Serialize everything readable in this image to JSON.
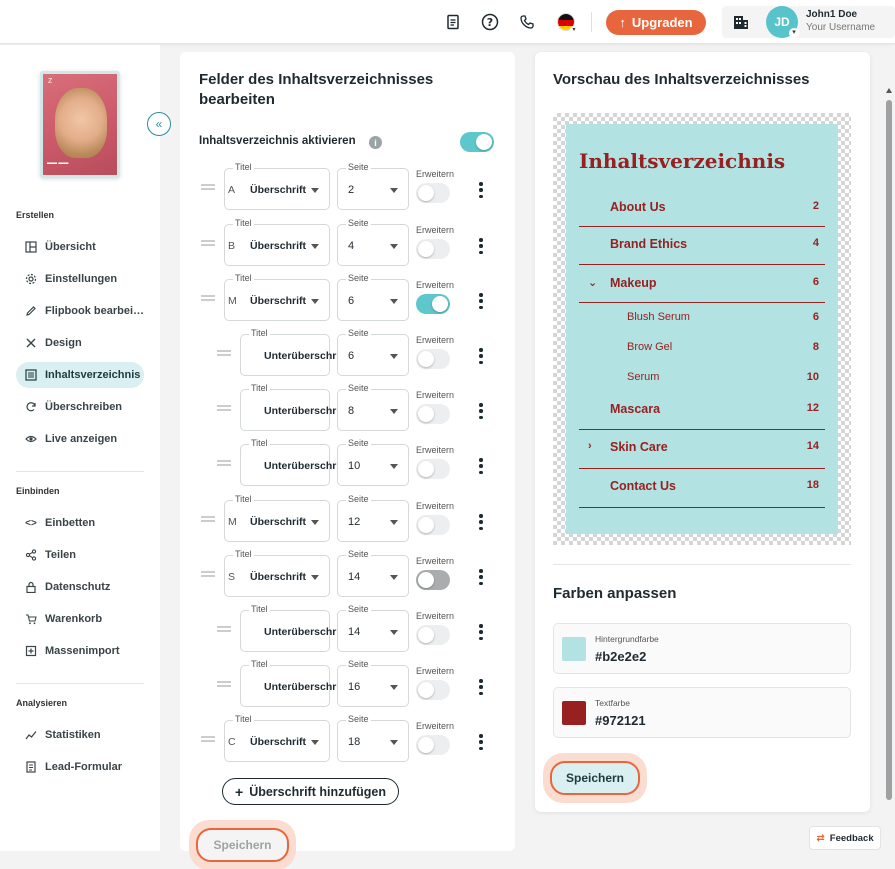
{
  "topbar": {
    "upgrade_label": "Upgraden",
    "user_name": "John1 Doe",
    "user_sub": "Your Username",
    "avatar_initials": "JD"
  },
  "sidebar": {
    "cover_logo": "Z",
    "sections": [
      {
        "label": "Erstellen"
      },
      {
        "label": "Einbinden"
      },
      {
        "label": "Analysieren"
      }
    ],
    "items": [
      {
        "label": "Übersicht",
        "icon": "layout-icon"
      },
      {
        "label": "Einstellungen",
        "icon": "gear-icon"
      },
      {
        "label": "Flipbook bearbei…",
        "icon": "pencil-icon"
      },
      {
        "label": "Design",
        "icon": "tools-icon"
      },
      {
        "label": "Inhaltsverzeichnis",
        "icon": "list-icon",
        "active": true
      },
      {
        "label": "Überschreiben",
        "icon": "refresh-icon"
      },
      {
        "label": "Live anzeigen",
        "icon": "eye-icon"
      },
      {
        "label": "Einbetten",
        "icon": "code-icon"
      },
      {
        "label": "Teilen",
        "icon": "share-icon"
      },
      {
        "label": "Datenschutz",
        "icon": "lock-icon"
      },
      {
        "label": "Warenkorb",
        "icon": "cart-icon"
      },
      {
        "label": "Massenimport",
        "icon": "import-icon"
      },
      {
        "label": "Statistiken",
        "icon": "chart-icon"
      },
      {
        "label": "Lead-Formular",
        "icon": "form-icon"
      }
    ]
  },
  "editor": {
    "title": "Felder des Inhaltsverzeichnisses bearbeiten",
    "activate_label": "Inhaltsverzeichnis aktivieren",
    "title_label": "Titel",
    "page_label": "Seite",
    "expand_label": "Erweitern",
    "rows": [
      {
        "level": "Überschrift",
        "prefix": "A",
        "page": "2",
        "expand": "off"
      },
      {
        "level": "Überschrift",
        "prefix": "B",
        "page": "4",
        "expand": "off"
      },
      {
        "level": "Überschrift",
        "prefix": "M",
        "page": "6",
        "expand": "on"
      },
      {
        "level": "Unterüberschrift",
        "prefix": "",
        "page": "6",
        "expand": "off"
      },
      {
        "level": "Unterüberschrift",
        "prefix": "",
        "page": "8",
        "expand": "off"
      },
      {
        "level": "Unterüberschrift",
        "prefix": "",
        "page": "10",
        "expand": "off"
      },
      {
        "level": "Überschrift",
        "prefix": "M",
        "page": "12",
        "expand": "off"
      },
      {
        "level": "Überschrift",
        "prefix": "S",
        "page": "14",
        "expand": "dark"
      },
      {
        "level": "Unterüberschrift",
        "prefix": "",
        "page": "14",
        "expand": "off"
      },
      {
        "level": "Unterüberschrift",
        "prefix": "",
        "page": "16",
        "expand": "off"
      },
      {
        "level": "Überschrift",
        "prefix": "C",
        "page": "18",
        "expand": "off"
      }
    ],
    "add_label": "Überschrift hinzufügen",
    "save_label": "Speichern"
  },
  "preview": {
    "title": "Vorschau des Inhaltsverzeichnisses",
    "toc_title": "Inhaltsverzeichnis",
    "entries": [
      {
        "label": "About Us",
        "page": "2",
        "sub": false,
        "chev": ""
      },
      {
        "label": "Brand Ethics",
        "page": "4",
        "sub": false,
        "chev": ""
      },
      {
        "label": "Makeup",
        "page": "6",
        "sub": false,
        "chev": "⌄"
      },
      {
        "label": "Blush Serum",
        "page": "6",
        "sub": true,
        "chev": ""
      },
      {
        "label": "Brow Gel",
        "page": "8",
        "sub": true,
        "chev": ""
      },
      {
        "label": "Serum",
        "page": "10",
        "sub": true,
        "chev": ""
      },
      {
        "label": "Mascara",
        "page": "12",
        "sub": false,
        "chev": ""
      },
      {
        "label": "Skin Care",
        "page": "14",
        "sub": false,
        "chev": "›"
      },
      {
        "label": "Contact Us",
        "page": "18",
        "sub": false,
        "chev": ""
      }
    ],
    "colors_title": "Farben anpassen",
    "bg_label": "Hintergrundfarbe",
    "bg_value": "#b2e2e2",
    "text_label": "Textfarbe",
    "text_value": "#972121",
    "save_label": "Speichern"
  },
  "feedback_label": "Feedback",
  "colors": {
    "accent": "#e8663d",
    "teal": "#5ec7cc",
    "toc_bg": "#b2e2e2",
    "toc_text": "#972121"
  }
}
